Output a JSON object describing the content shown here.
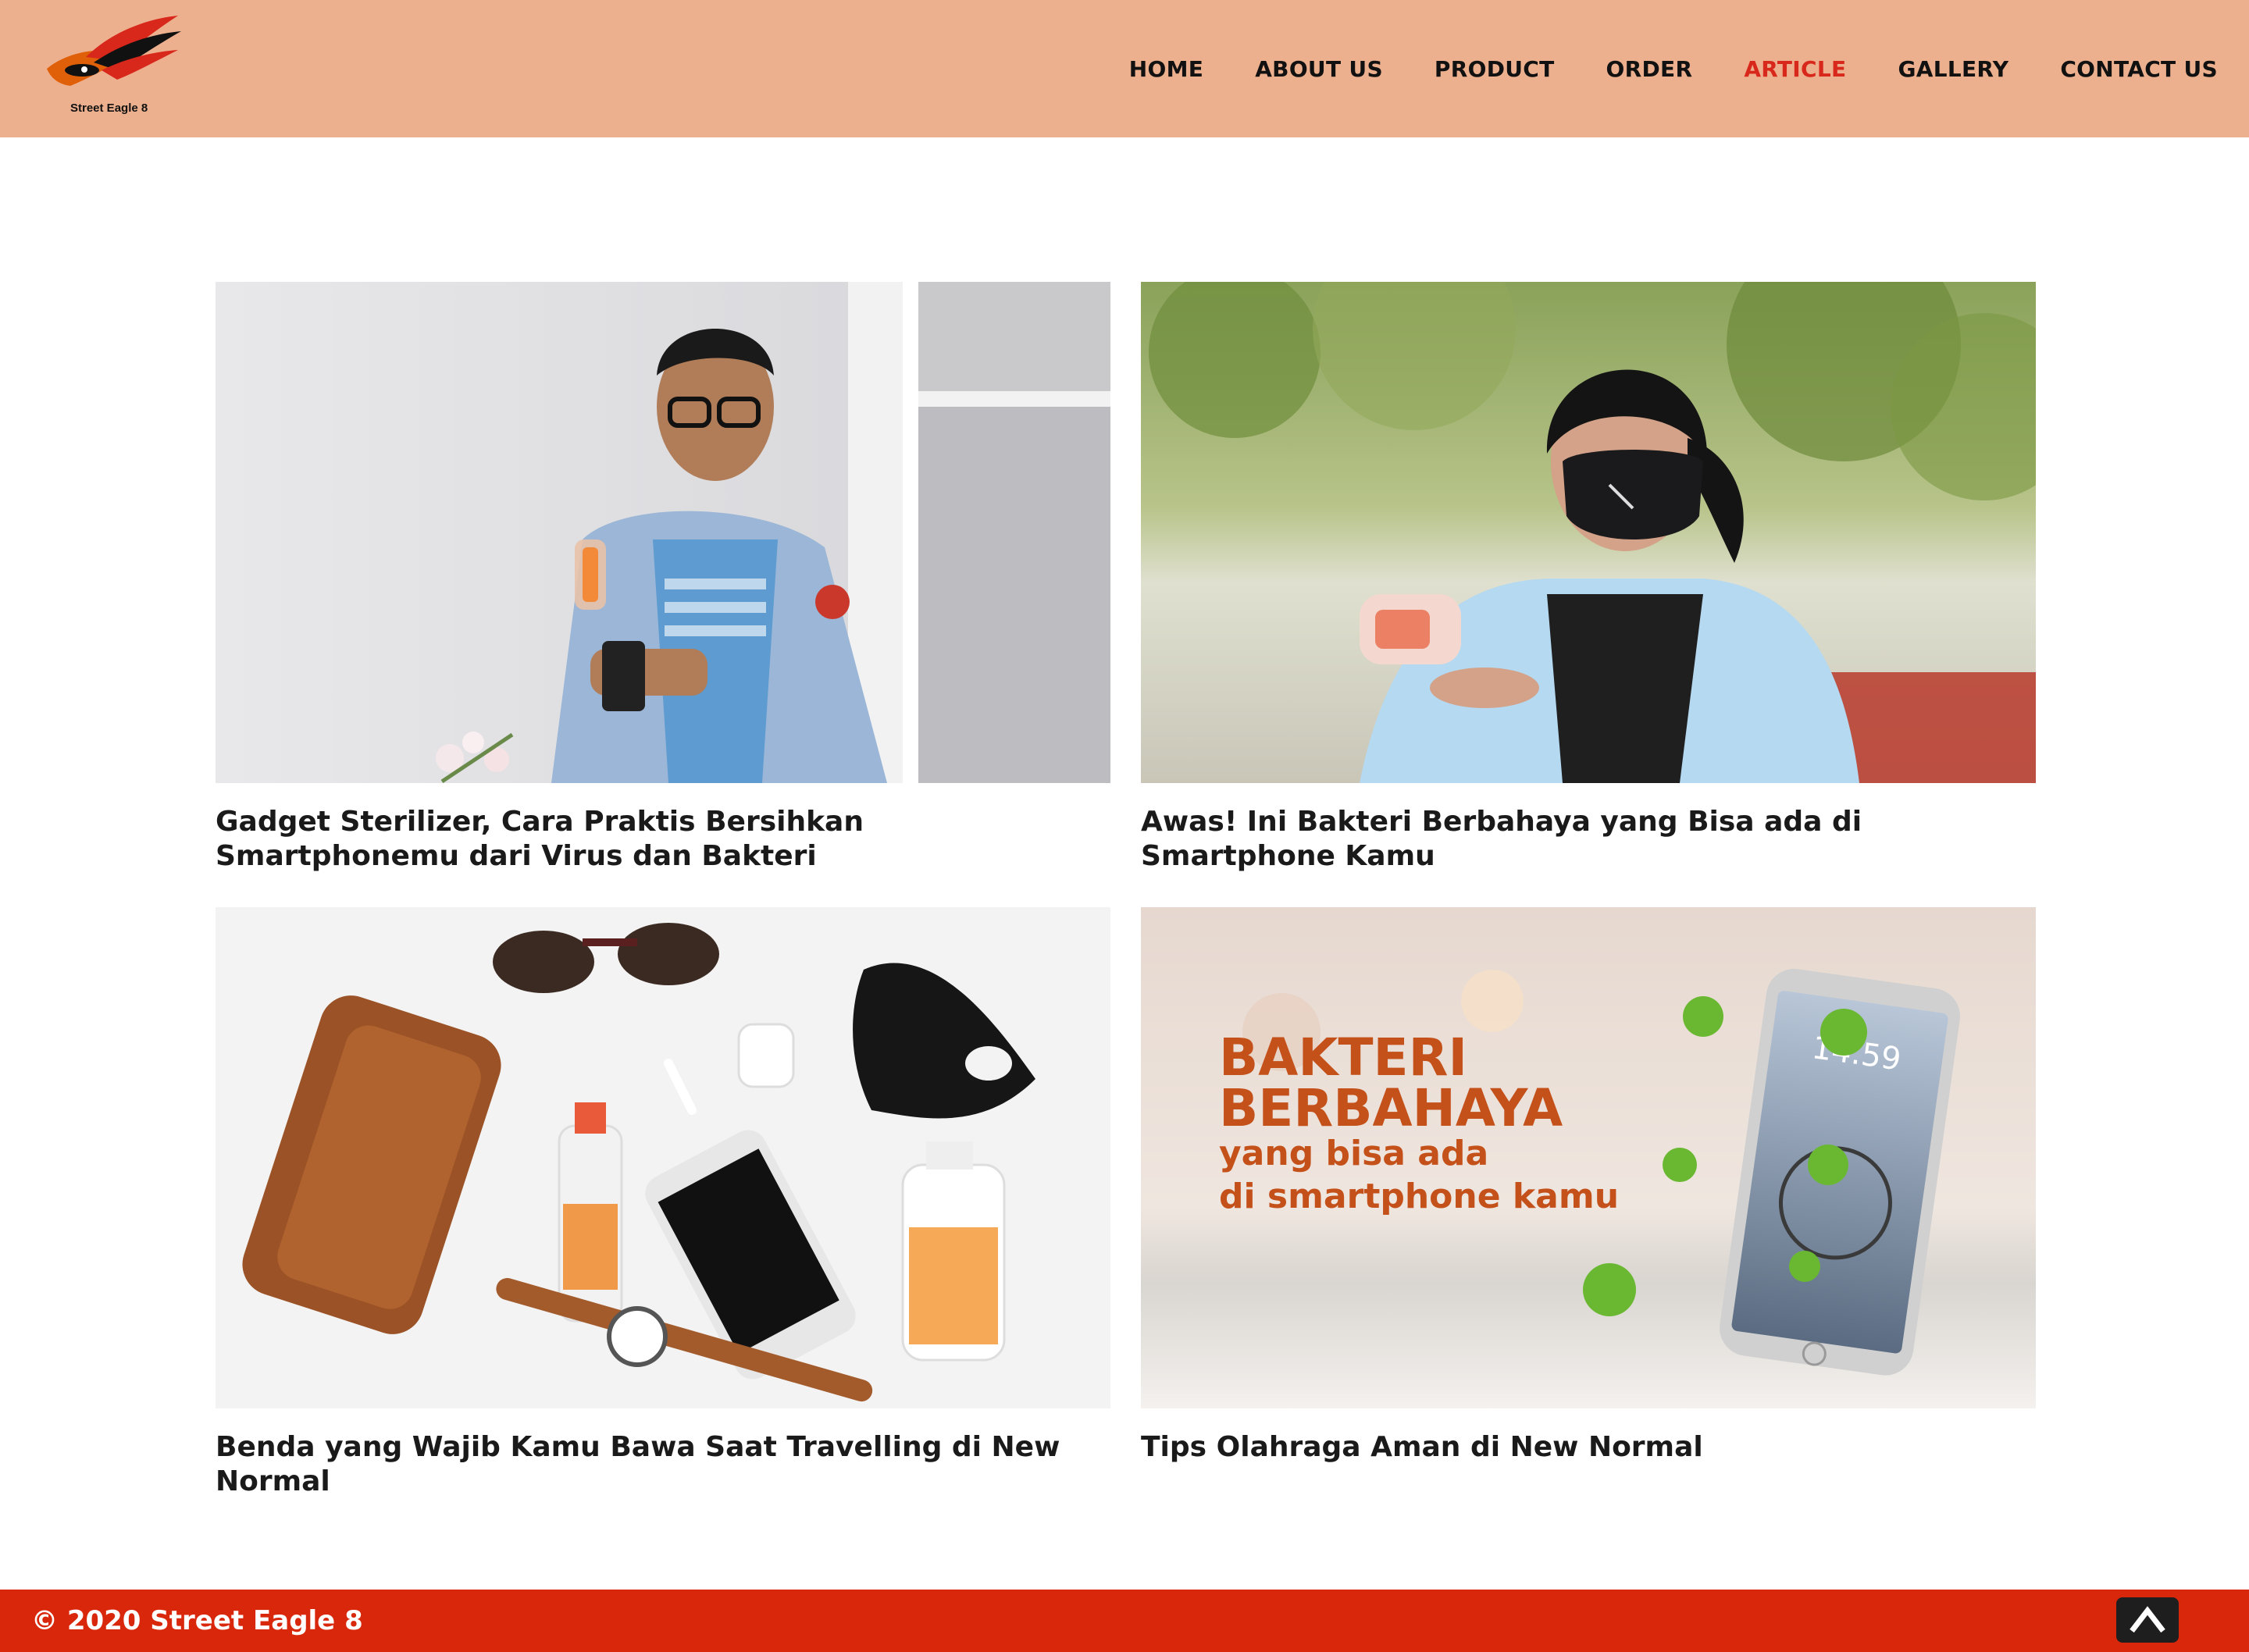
{
  "brand": {
    "name": "Street Eagle 8",
    "logo_icon": "eagle-wing-eye-logo",
    "colors": {
      "header_bg": "#edb08e",
      "accent": "#d8271b",
      "footer_bg": "#d8270b"
    }
  },
  "nav": {
    "items": [
      {
        "label": "HOME",
        "active": false
      },
      {
        "label": "ABOUT US",
        "active": false
      },
      {
        "label": "PRODUCT",
        "active": false
      },
      {
        "label": "ORDER",
        "active": false
      },
      {
        "label": "ARTICLE",
        "active": true
      },
      {
        "label": "GALLERY",
        "active": false
      },
      {
        "label": "CONTACT US",
        "active": false
      }
    ]
  },
  "articles": [
    {
      "title": "Gadget Sterilizer, Cara Praktis Bersihkan Smartphonemu dari Virus dan Bakteri"
    },
    {
      "title": "Awas! Ini Bakteri Berbahaya yang Bisa ada di Smartphone Kamu"
    },
    {
      "title": "Benda yang Wajib Kamu Bawa Saat Travelling di New Normal"
    },
    {
      "title": "Tips Olahraga Aman di New Normal",
      "image_text": {
        "line1": "BAKTERI",
        "line2": "BERBAHAYA",
        "line3": "yang bisa ada",
        "line4": "di smartphone kamu",
        "phone_time": "14.59"
      }
    }
  ],
  "footer": {
    "copyright": "© 2020 Street Eagle 8",
    "back_to_top_icon": "chevron-up-icon"
  }
}
